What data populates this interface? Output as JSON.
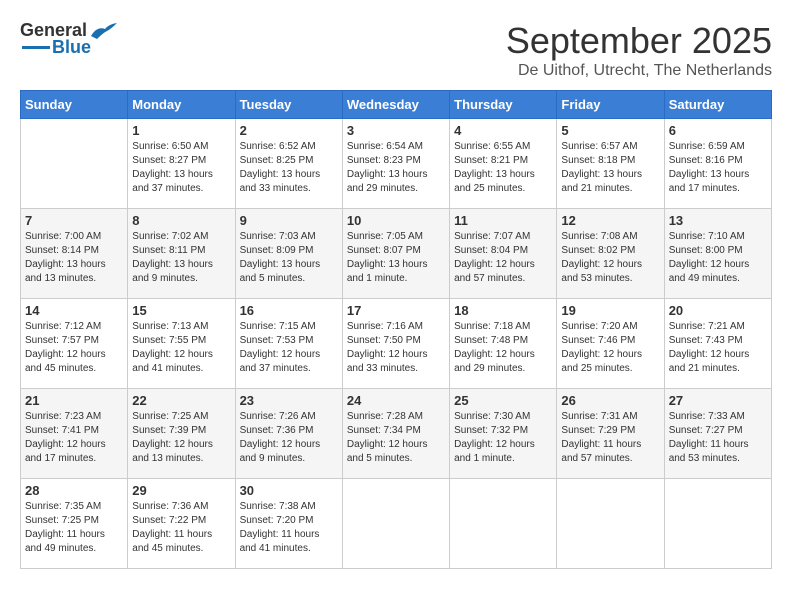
{
  "header": {
    "logo_general": "General",
    "logo_blue": "Blue",
    "month": "September 2025",
    "location": "De Uithof, Utrecht, The Netherlands"
  },
  "calendar": {
    "days_of_week": [
      "Sunday",
      "Monday",
      "Tuesday",
      "Wednesday",
      "Thursday",
      "Friday",
      "Saturday"
    ],
    "weeks": [
      [
        {
          "day": "",
          "info": ""
        },
        {
          "day": "1",
          "info": "Sunrise: 6:50 AM\nSunset: 8:27 PM\nDaylight: 13 hours\nand 37 minutes."
        },
        {
          "day": "2",
          "info": "Sunrise: 6:52 AM\nSunset: 8:25 PM\nDaylight: 13 hours\nand 33 minutes."
        },
        {
          "day": "3",
          "info": "Sunrise: 6:54 AM\nSunset: 8:23 PM\nDaylight: 13 hours\nand 29 minutes."
        },
        {
          "day": "4",
          "info": "Sunrise: 6:55 AM\nSunset: 8:21 PM\nDaylight: 13 hours\nand 25 minutes."
        },
        {
          "day": "5",
          "info": "Sunrise: 6:57 AM\nSunset: 8:18 PM\nDaylight: 13 hours\nand 21 minutes."
        },
        {
          "day": "6",
          "info": "Sunrise: 6:59 AM\nSunset: 8:16 PM\nDaylight: 13 hours\nand 17 minutes."
        }
      ],
      [
        {
          "day": "7",
          "info": "Sunrise: 7:00 AM\nSunset: 8:14 PM\nDaylight: 13 hours\nand 13 minutes."
        },
        {
          "day": "8",
          "info": "Sunrise: 7:02 AM\nSunset: 8:11 PM\nDaylight: 13 hours\nand 9 minutes."
        },
        {
          "day": "9",
          "info": "Sunrise: 7:03 AM\nSunset: 8:09 PM\nDaylight: 13 hours\nand 5 minutes."
        },
        {
          "day": "10",
          "info": "Sunrise: 7:05 AM\nSunset: 8:07 PM\nDaylight: 13 hours\nand 1 minute."
        },
        {
          "day": "11",
          "info": "Sunrise: 7:07 AM\nSunset: 8:04 PM\nDaylight: 12 hours\nand 57 minutes."
        },
        {
          "day": "12",
          "info": "Sunrise: 7:08 AM\nSunset: 8:02 PM\nDaylight: 12 hours\nand 53 minutes."
        },
        {
          "day": "13",
          "info": "Sunrise: 7:10 AM\nSunset: 8:00 PM\nDaylight: 12 hours\nand 49 minutes."
        }
      ],
      [
        {
          "day": "14",
          "info": "Sunrise: 7:12 AM\nSunset: 7:57 PM\nDaylight: 12 hours\nand 45 minutes."
        },
        {
          "day": "15",
          "info": "Sunrise: 7:13 AM\nSunset: 7:55 PM\nDaylight: 12 hours\nand 41 minutes."
        },
        {
          "day": "16",
          "info": "Sunrise: 7:15 AM\nSunset: 7:53 PM\nDaylight: 12 hours\nand 37 minutes."
        },
        {
          "day": "17",
          "info": "Sunrise: 7:16 AM\nSunset: 7:50 PM\nDaylight: 12 hours\nand 33 minutes."
        },
        {
          "day": "18",
          "info": "Sunrise: 7:18 AM\nSunset: 7:48 PM\nDaylight: 12 hours\nand 29 minutes."
        },
        {
          "day": "19",
          "info": "Sunrise: 7:20 AM\nSunset: 7:46 PM\nDaylight: 12 hours\nand 25 minutes."
        },
        {
          "day": "20",
          "info": "Sunrise: 7:21 AM\nSunset: 7:43 PM\nDaylight: 12 hours\nand 21 minutes."
        }
      ],
      [
        {
          "day": "21",
          "info": "Sunrise: 7:23 AM\nSunset: 7:41 PM\nDaylight: 12 hours\nand 17 minutes."
        },
        {
          "day": "22",
          "info": "Sunrise: 7:25 AM\nSunset: 7:39 PM\nDaylight: 12 hours\nand 13 minutes."
        },
        {
          "day": "23",
          "info": "Sunrise: 7:26 AM\nSunset: 7:36 PM\nDaylight: 12 hours\nand 9 minutes."
        },
        {
          "day": "24",
          "info": "Sunrise: 7:28 AM\nSunset: 7:34 PM\nDaylight: 12 hours\nand 5 minutes."
        },
        {
          "day": "25",
          "info": "Sunrise: 7:30 AM\nSunset: 7:32 PM\nDaylight: 12 hours\nand 1 minute."
        },
        {
          "day": "26",
          "info": "Sunrise: 7:31 AM\nSunset: 7:29 PM\nDaylight: 11 hours\nand 57 minutes."
        },
        {
          "day": "27",
          "info": "Sunrise: 7:33 AM\nSunset: 7:27 PM\nDaylight: 11 hours\nand 53 minutes."
        }
      ],
      [
        {
          "day": "28",
          "info": "Sunrise: 7:35 AM\nSunset: 7:25 PM\nDaylight: 11 hours\nand 49 minutes."
        },
        {
          "day": "29",
          "info": "Sunrise: 7:36 AM\nSunset: 7:22 PM\nDaylight: 11 hours\nand 45 minutes."
        },
        {
          "day": "30",
          "info": "Sunrise: 7:38 AM\nSunset: 7:20 PM\nDaylight: 11 hours\nand 41 minutes."
        },
        {
          "day": "",
          "info": ""
        },
        {
          "day": "",
          "info": ""
        },
        {
          "day": "",
          "info": ""
        },
        {
          "day": "",
          "info": ""
        }
      ]
    ]
  }
}
